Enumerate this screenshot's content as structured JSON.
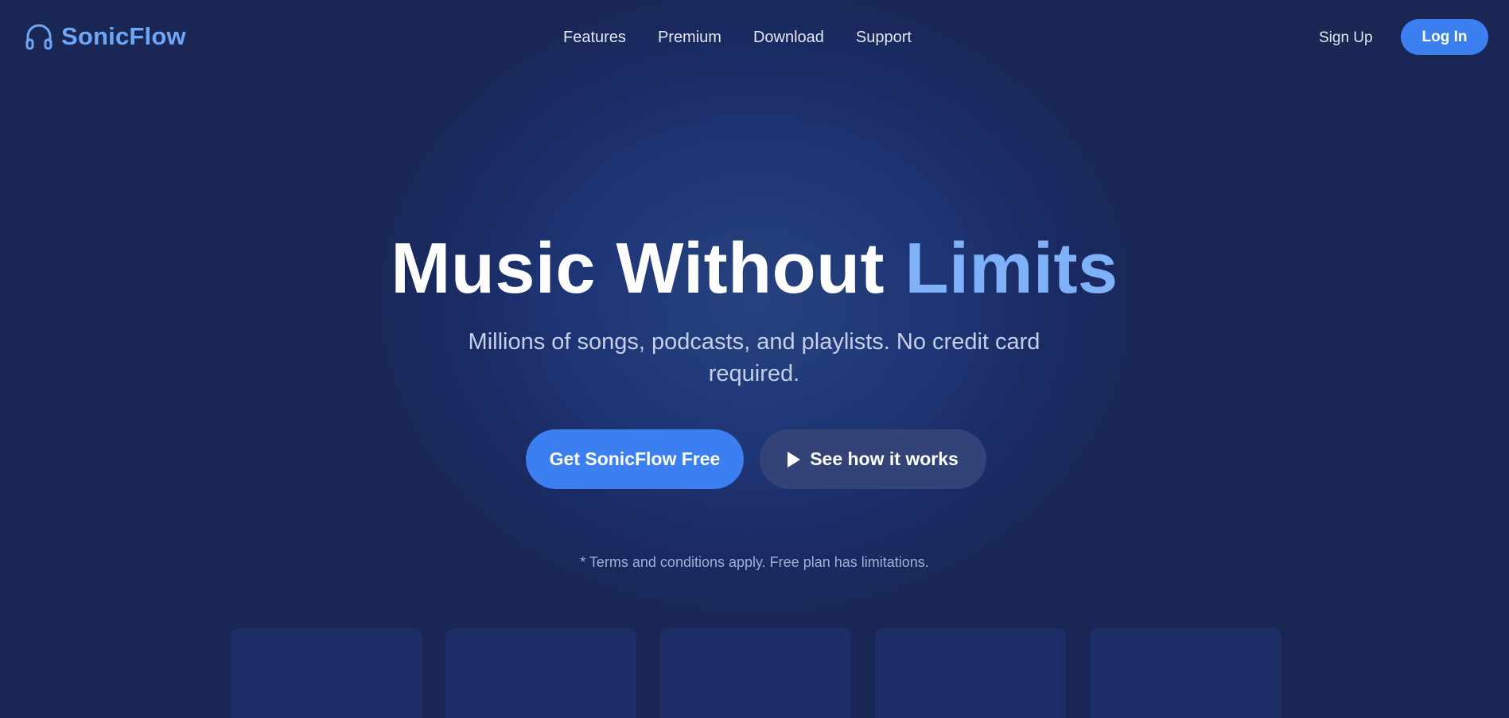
{
  "brand": {
    "name": "SonicFlow",
    "icon": "headphones-icon",
    "accent_color": "#6fa7f7"
  },
  "nav": {
    "links": [
      "Features",
      "Premium",
      "Download",
      "Support"
    ],
    "signup_label": "Sign Up",
    "login_label": "Log In"
  },
  "hero": {
    "title_main": "Music Without ",
    "title_accent": "Limits",
    "subtitle": "Millions of songs, podcasts, and playlists. No credit card required.",
    "primary_cta": "Get SonicFlow Free",
    "secondary_cta": "See how it works",
    "secondary_icon": "play-icon",
    "terms": "* Terms and conditions apply. Free plan has limitations."
  },
  "colors": {
    "background": "#1a2654",
    "primary_button": "#3b7ff0",
    "secondary_button": "#344377",
    "card": "#1d2d68"
  }
}
